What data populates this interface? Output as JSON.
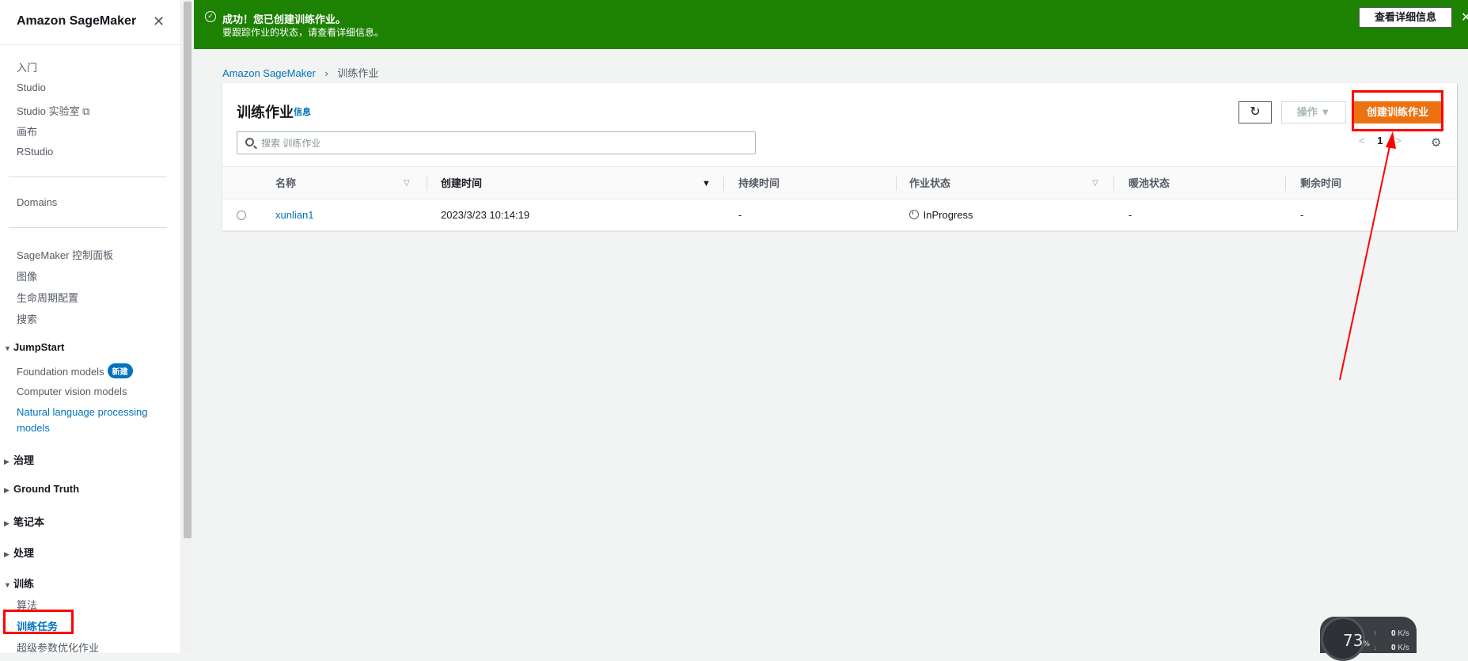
{
  "sidebar": {
    "title": "Amazon SageMaker",
    "close_icon": "close-icon",
    "group1": [
      "入门",
      "Studio",
      "Studio 实验室",
      "画布",
      "RStudio"
    ],
    "group2": [
      "Domains"
    ],
    "group3": [
      "SageMaker 控制面板",
      "图像",
      "生命周期配置",
      "搜索"
    ],
    "jumpstart": {
      "label": "JumpStart",
      "items": [
        "Foundation models",
        "Computer vision models"
      ],
      "badge": "新建",
      "nlp_line1": "Natural language processing",
      "nlp_line2": "models"
    },
    "sections": [
      "治理",
      "Ground Truth",
      "笔记本",
      "处理"
    ],
    "training": {
      "label": "训练",
      "items": [
        "算法",
        "训练任务",
        "超级参数优化作业"
      ]
    }
  },
  "flash": {
    "title": "成功！您已创建训练作业。",
    "message": "要跟踪作业的状态，请查看详细信息。",
    "button": "查看详细信息",
    "color": "#1d8102"
  },
  "breadcrumb": {
    "root": "Amazon SageMaker",
    "current": "训练作业"
  },
  "panel": {
    "title": "训练作业",
    "info": "信息",
    "action_button": "操作",
    "create_button": "创建训练作业",
    "search_placeholder": "搜索 训练作业",
    "page": "1"
  },
  "table": {
    "columns": [
      "名称",
      "创建时间",
      "持续时间",
      "作业状态",
      "暖池状态",
      "剩余时间"
    ],
    "rows": [
      {
        "name": "xunlian1",
        "created": "2023/3/23 10:14:19",
        "duration": "-",
        "status": "InProgress",
        "warm_pool": "-",
        "remaining": "-"
      }
    ]
  },
  "widget": {
    "cpu": "73",
    "cpu_unit": "%",
    "up_value": "0",
    "up_unit": "K/s",
    "down_value": "0",
    "down_unit": "K/s"
  },
  "colors": {
    "accent": "#ec7211",
    "link": "#0073bb",
    "highlight": "#ff0000"
  }
}
